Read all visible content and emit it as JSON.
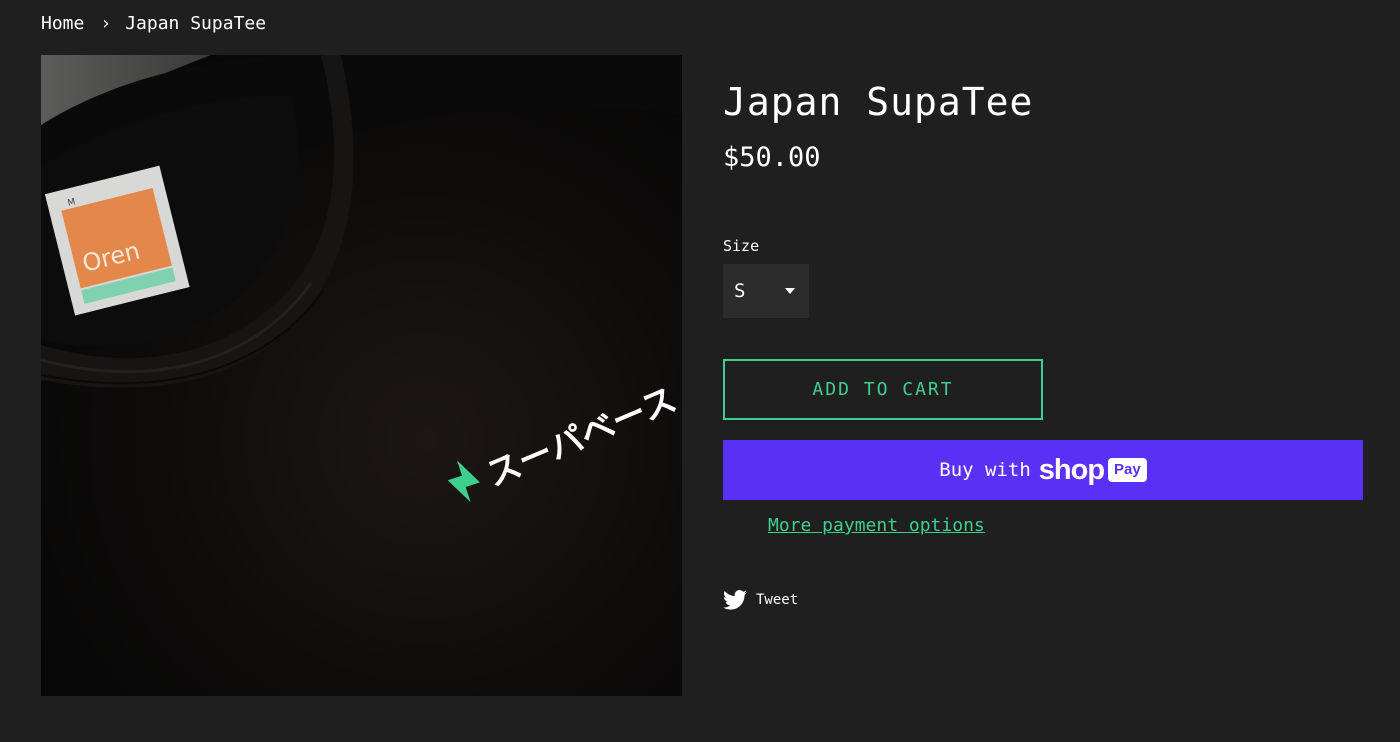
{
  "breadcrumb": {
    "home": "Home",
    "separator": "›",
    "current": "Japan SupaTee"
  },
  "product": {
    "title": "Japan SupaTee",
    "price": "$50.00",
    "size_label": "Size",
    "size_selected": "S",
    "image": {
      "tag_brand": "Oren",
      "tag_size": "M",
      "print_text": "スーパベース"
    }
  },
  "actions": {
    "add_to_cart": "ADD TO CART",
    "buy_with": "Buy with",
    "shop_word": "shop",
    "pay_badge": "Pay",
    "more_payment": "More payment options",
    "tweet": "Tweet"
  },
  "colors": {
    "background": "#1f1f1f",
    "accent": "#3ecf8e",
    "shop_pay": "#5a31f4",
    "select_bg": "#2c2c2c"
  },
  "icons": {
    "dropdown": "chevron-down-icon",
    "twitter": "twitter-icon",
    "logo": "supabase-logo-icon"
  }
}
